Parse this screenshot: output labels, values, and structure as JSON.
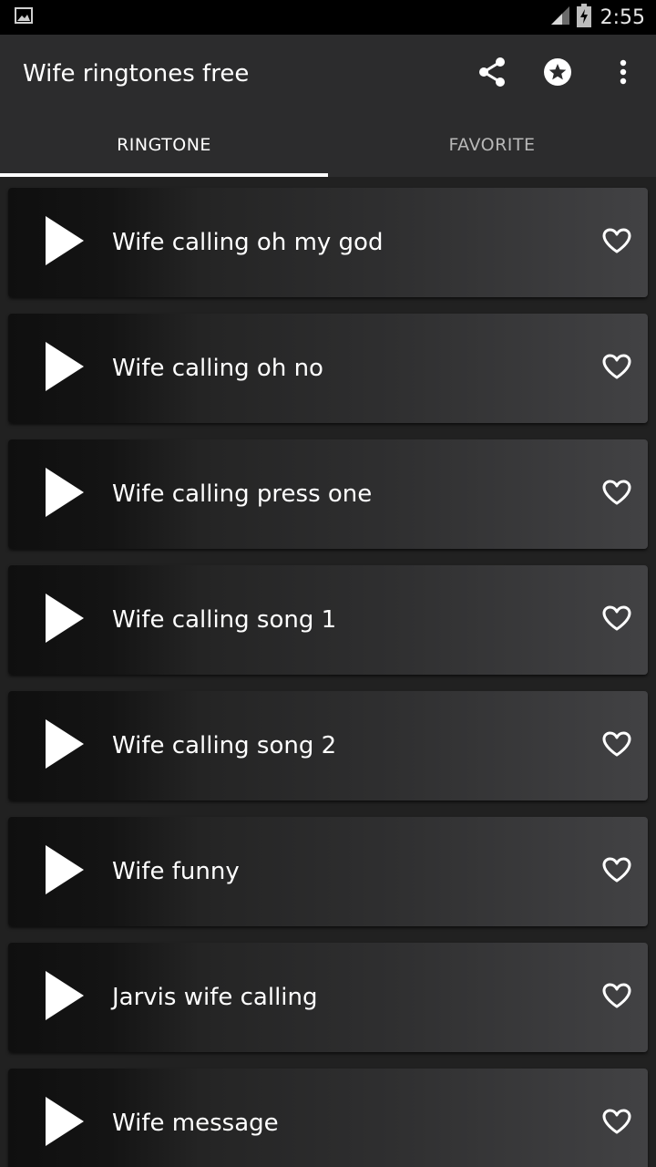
{
  "status_bar": {
    "time": "2:55",
    "icons": [
      "image-notification-icon",
      "signal-icon",
      "battery-charging-icon"
    ]
  },
  "app_bar": {
    "title": "Wife ringtones free",
    "actions": [
      "share-icon",
      "star-icon",
      "more-vert-icon"
    ]
  },
  "tabs": [
    {
      "label": "RINGTONE",
      "active": true
    },
    {
      "label": "FAVORITE",
      "active": false
    }
  ],
  "ringtones": [
    {
      "title": "Wife calling oh my god"
    },
    {
      "title": "Wife calling oh no"
    },
    {
      "title": "Wife calling press one"
    },
    {
      "title": "Wife calling song 1"
    },
    {
      "title": "Wife calling song 2"
    },
    {
      "title": "Wife funny"
    },
    {
      "title": "Jarvis wife calling"
    },
    {
      "title": "Wife message"
    }
  ],
  "colors": {
    "background": "#212121",
    "app_bar": "#2c2c2d",
    "status_bar": "#000000",
    "tab_indicator": "#ffffff"
  }
}
